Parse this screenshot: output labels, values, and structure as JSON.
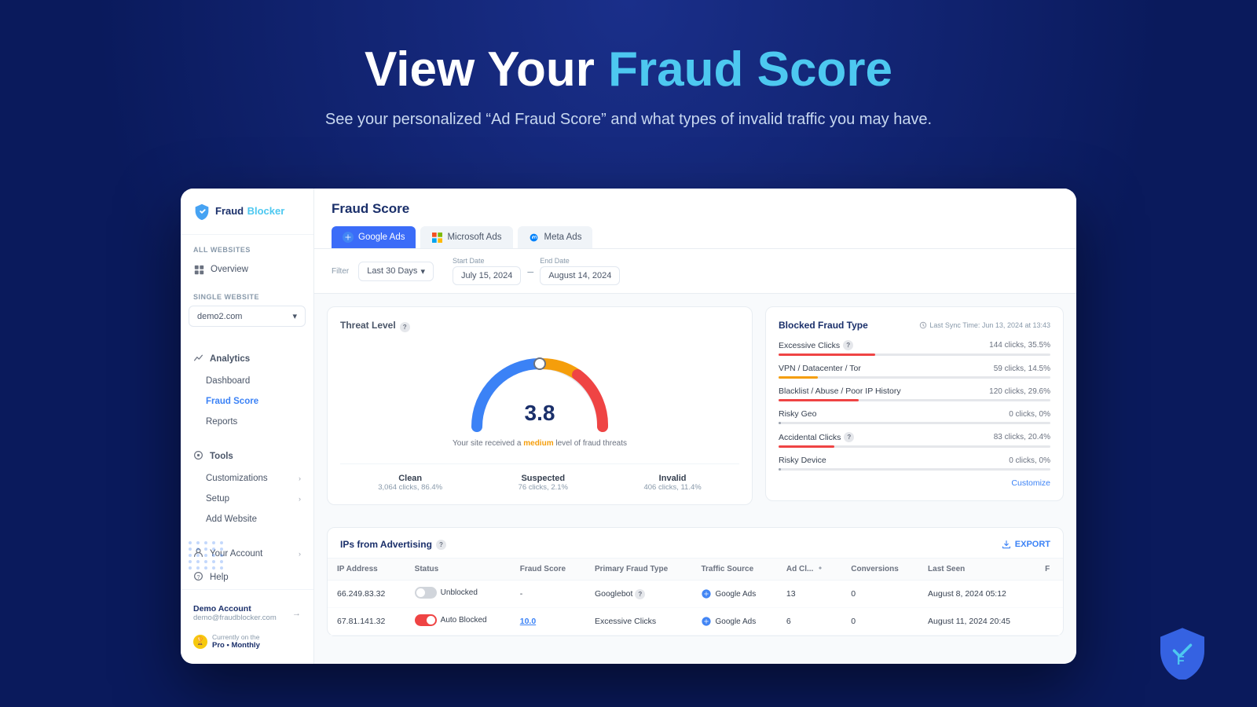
{
  "hero": {
    "title_white": "View Your",
    "title_accent": "Fraud Score",
    "subtitle": "See your personalized “Ad Fraud Score” and what types of invalid traffic you may have."
  },
  "sidebar": {
    "logo_text_white": "Fraud",
    "logo_text_accent": "Blocker",
    "all_websites_label": "All Websites",
    "overview_label": "Overview",
    "single_website_label": "Single Website",
    "website_name": "demo2.com",
    "analytics_label": "Analytics",
    "dashboard_label": "Dashboard",
    "fraud_score_label": "Fraud Score",
    "reports_label": "Reports",
    "tools_label": "Tools",
    "customizations_label": "Customizations",
    "setup_label": "Setup",
    "add_website_label": "Add Website",
    "your_account_label": "Your Account",
    "help_label": "Help",
    "account_name": "Demo Account",
    "account_email": "demo@fraudblocker.com",
    "plan_label": "Currently on the",
    "plan_name": "Pro • Monthly"
  },
  "fraud_score": {
    "title": "Fraud Score",
    "gauge_value": "3.8",
    "gauge_subtitle_pre": "Your site received a",
    "gauge_level": "medium",
    "gauge_subtitle_post": "level of fraud threats"
  },
  "tabs": [
    {
      "label": "Google Ads",
      "active": true
    },
    {
      "label": "Microsoft Ads",
      "active": false
    },
    {
      "label": "Meta Ads",
      "active": false
    }
  ],
  "filter": {
    "label": "Filter",
    "range": "Last 30 Days",
    "start_label": "Start Date",
    "start_date": "July 15, 2024",
    "end_label": "End Date",
    "end_date": "August 14, 2024"
  },
  "threat_level": {
    "title": "Threat Level",
    "stats": [
      {
        "label": "Clean",
        "value": "3,064 clicks, 86.4%"
      },
      {
        "label": "Suspected",
        "value": "76 clicks, 2.1%"
      },
      {
        "label": "Invalid",
        "value": "406 clicks, 11.4%"
      }
    ]
  },
  "blocked_fraud": {
    "title": "Blocked Fraud Type",
    "sync_time": "Last Sync Time: Jun 13, 2024 at 13:43",
    "types": [
      {
        "name": "Excessive Clicks",
        "info": true,
        "count": "144 clicks, 35.5%",
        "pct": 35.5,
        "color": "red"
      },
      {
        "name": "VPN / Datacenter / Tor",
        "info": false,
        "count": "59 clicks, 14.5%",
        "pct": 14.5,
        "color": "orange"
      },
      {
        "name": "Blacklist / Abuse / Poor IP History",
        "info": false,
        "count": "120 clicks, 29.6%",
        "pct": 29.6,
        "color": "red"
      },
      {
        "name": "Risky Geo",
        "info": false,
        "count": "0 clicks, 0%",
        "pct": 0,
        "color": "gray"
      },
      {
        "name": "Accidental Clicks",
        "info": true,
        "count": "83 clicks, 20.4%",
        "pct": 20.4,
        "color": "red"
      },
      {
        "name": "Risky Device",
        "info": false,
        "count": "0 clicks, 0%",
        "pct": 0,
        "color": "gray"
      }
    ],
    "customize_label": "Customize"
  },
  "ips_table": {
    "title": "IPs from Advertising",
    "export_label": "EXPORT",
    "columns": [
      "IP Address",
      "Status",
      "Fraud Score",
      "Primary Fraud Type",
      "Traffic Source",
      "Ad Cl...",
      "Conversions",
      "Last Seen",
      "F"
    ],
    "rows": [
      {
        "ip": "66.249.83.32",
        "status": "Unblocked",
        "status_type": "off",
        "score": "-",
        "score_link": false,
        "fraud_type": "Googlebot",
        "fraud_info": true,
        "source": "Google Ads",
        "ad_clicks": "13",
        "conversions": "0",
        "last_seen": "August 8, 2024 05:12",
        "f": ""
      },
      {
        "ip": "67.81.141.32",
        "status": "Auto Blocked",
        "status_type": "on",
        "score": "10.0",
        "score_link": true,
        "fraud_type": "Excessive Clicks",
        "fraud_info": false,
        "source": "Google Ads",
        "ad_clicks": "6",
        "conversions": "0",
        "last_seen": "August 11, 2024 20:45",
        "f": ""
      }
    ]
  },
  "bottom_shield": {
    "visible": true
  }
}
